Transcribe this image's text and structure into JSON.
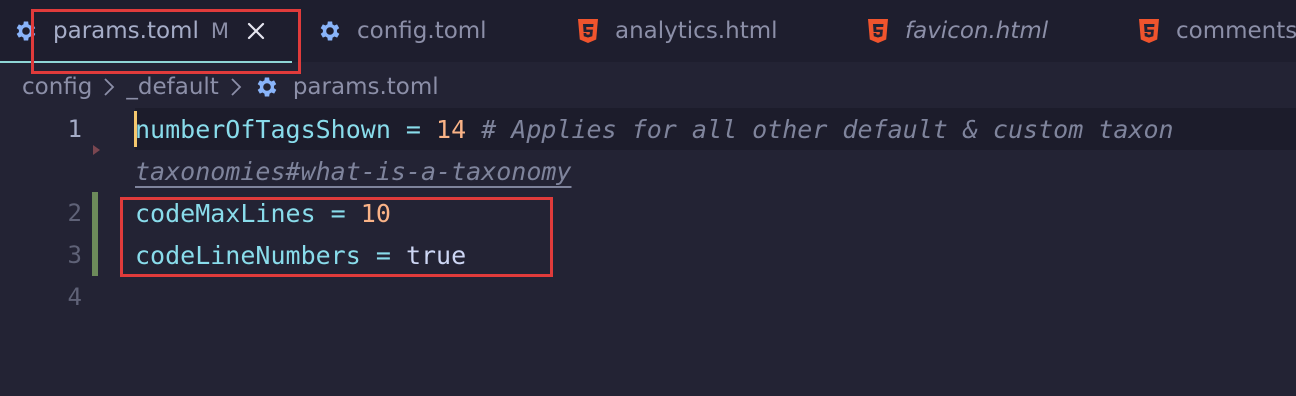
{
  "tabs": [
    {
      "label": "params.toml",
      "modified": "M",
      "icon": "gear-icon",
      "active": true
    },
    {
      "label": "config.toml",
      "icon": "gear-icon",
      "active": false
    },
    {
      "label": "analytics.html",
      "icon": "html5-icon",
      "active": false
    },
    {
      "label": "favicon.html",
      "icon": "html5-icon",
      "active": false,
      "italic": true
    },
    {
      "label": "comments",
      "icon": "html5-icon",
      "active": false
    }
  ],
  "breadcrumb": [
    "config",
    "_default",
    "params.toml"
  ],
  "editor": {
    "line_numbers": [
      "1",
      "2",
      "3",
      "4"
    ],
    "line1": {
      "key": "numberOfTagsShown",
      "op": " = ",
      "value": "14",
      "comment": " # Applies for all other default & custom taxon",
      "wrap": "taxonomies#what-is-a-taxonomy"
    },
    "line2": {
      "key": "codeMaxLines",
      "op": " = ",
      "value": "10"
    },
    "line3": {
      "key": "codeLineNumbers",
      "op": " = ",
      "value": "true"
    }
  },
  "colors": {
    "background": "#232334",
    "tab_bar": "#1e1e2e",
    "gear_icon": "#89b4fa",
    "html_icon": "#f0542d",
    "highlight_box": "#e03b3b",
    "git_modified": "#6c8a5a",
    "cursor": "#f5c86e"
  }
}
